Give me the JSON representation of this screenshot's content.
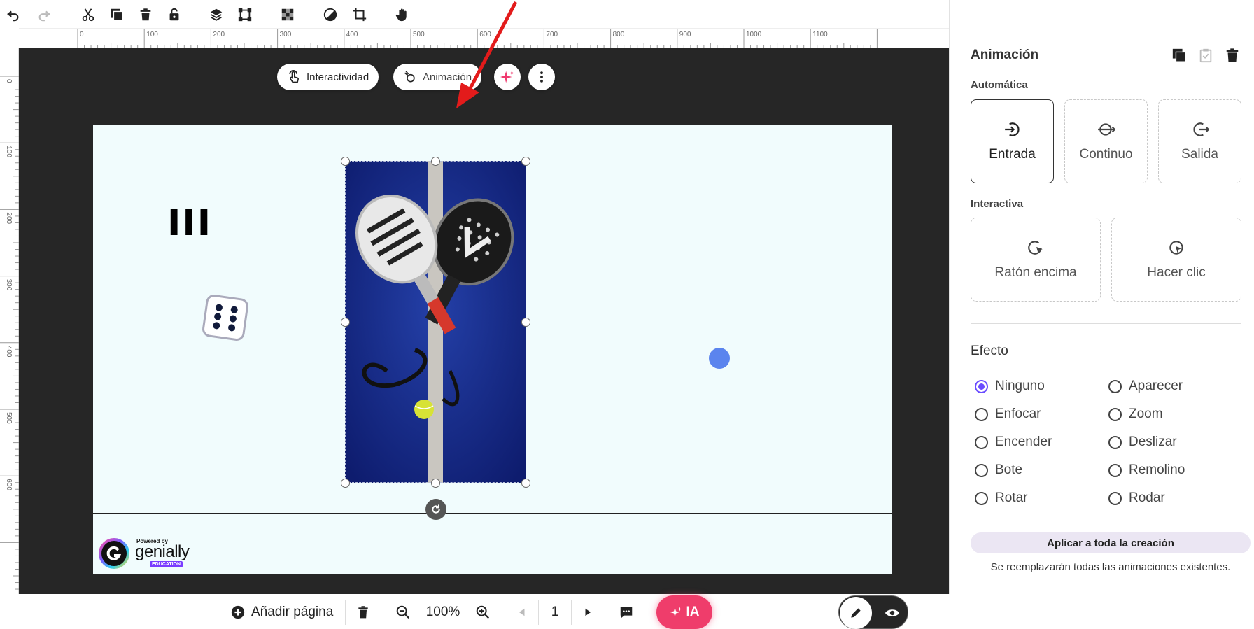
{
  "toolbar": {
    "icons": [
      "undo-icon",
      "redo-icon",
      "cut-icon",
      "duplicate-icon",
      "delete-icon",
      "unlock-icon",
      "layers-icon",
      "transform-icon",
      "transparency-icon",
      "filter-icon",
      "crop-icon",
      "hand-icon"
    ]
  },
  "rulers": {
    "top": [
      "0",
      "100",
      "200",
      "300",
      "400",
      "500",
      "600",
      "700",
      "800",
      "900",
      "1000",
      "1100"
    ],
    "left": [
      "0",
      "100",
      "200",
      "300",
      "400",
      "500",
      "600"
    ]
  },
  "element_toolbar": {
    "interactivity_label": "Interactividad",
    "animation_label": "Animación"
  },
  "canvas": {
    "text_element": "III",
    "logo": {
      "powered_by": "Powered by",
      "brand": "genially",
      "badge": "EDUCATION"
    },
    "colors": {
      "background": "#f1fcfd",
      "dot": "#5b84ee",
      "court": "#1d3296"
    }
  },
  "bottom_bar": {
    "add_page_label": "Añadir página",
    "zoom": "100%",
    "page": "1",
    "ai_label": "IA"
  },
  "panel": {
    "title": "Animación",
    "automatic_label": "Automática",
    "automatic_options": [
      {
        "label": "Entrada",
        "icon": "enter-icon",
        "selected": true
      },
      {
        "label": "Continuo",
        "icon": "continuous-icon",
        "selected": false
      },
      {
        "label": "Salida",
        "icon": "exit-icon",
        "selected": false
      }
    ],
    "interactive_label": "Interactiva",
    "interactive_options": [
      {
        "label": "Ratón encima",
        "icon": "hover-icon"
      },
      {
        "label": "Hacer clic",
        "icon": "click-icon"
      }
    ],
    "effect_label": "Efecto",
    "effects": [
      "Ninguno",
      "Aparecer",
      "Enfocar",
      "Zoom",
      "Encender",
      "Deslizar",
      "Bote",
      "Remolino",
      "Rotar",
      "Rodar"
    ],
    "selected_effect": "Ninguno",
    "apply_all_label": "Aplicar a toda la creación",
    "replace_note": "Se reemplazarán todas las animaciones existentes.",
    "accent_color": "#6a4cff"
  }
}
